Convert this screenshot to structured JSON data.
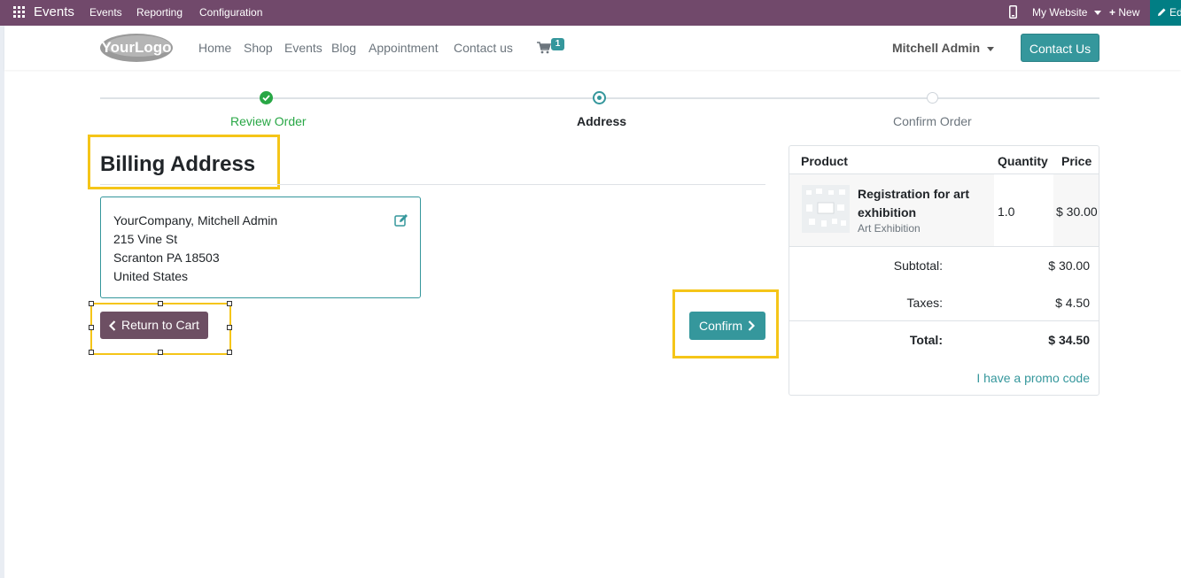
{
  "topbar": {
    "app_name": "Events",
    "menu": [
      "Events",
      "Reporting",
      "Configuration"
    ],
    "website_selector": "My Website",
    "new_label": "New",
    "edit_label": "Ed"
  },
  "header": {
    "logo_text": "YourLogo",
    "nav": [
      "Home",
      "Shop",
      "Events",
      "Blog",
      "Appointment",
      "Contact us"
    ],
    "cart_count": "1",
    "user_name": "Mitchell Admin",
    "contact_button": "Contact Us"
  },
  "wizard": {
    "steps": [
      "Review Order",
      "Address",
      "Confirm Order"
    ],
    "current_step": "Address"
  },
  "billing": {
    "title": "Billing Address",
    "address_lines": [
      "YourCompany, Mitchell Admin",
      "215 Vine St",
      "Scranton PA 18503",
      "United States"
    ],
    "return_button": "Return to Cart",
    "confirm_button": "Confirm"
  },
  "summary": {
    "columns": [
      "Product",
      "Quantity",
      "Price"
    ],
    "product_name": "Registration for art exhibition",
    "product_subtitle": "Art Exhibition",
    "quantity": "1.0",
    "price": "$ 30.00",
    "subtotal_label": "Subtotal:",
    "subtotal_value": "$ 30.00",
    "taxes_label": "Taxes:",
    "taxes_value": "$ 4.50",
    "total_label": "Total:",
    "total_value": "$ 34.50",
    "promo_link": "I have a promo code"
  },
  "colors": {
    "topbar": "#71496b",
    "accent": "#35979c",
    "success": "#28a745",
    "highlight": "#f5c518",
    "secondary_button": "#6d4f63"
  }
}
